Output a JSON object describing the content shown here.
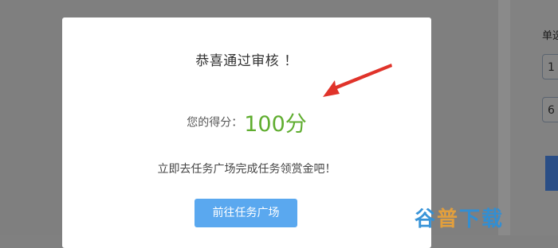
{
  "background": {
    "right_label": "单选",
    "input_one_value": "1",
    "input_two_value": "6"
  },
  "modal": {
    "title": "恭喜通过审核 ！",
    "score_label": "您的得分：",
    "score_value": "100分",
    "instruction": "立即去任务广场完成任务领赏金吧！",
    "button_label": "前往任务广场"
  },
  "watermark": {
    "text_part1": "谷",
    "text_part2": "普",
    "text_part3": "下载"
  },
  "colors": {
    "score_green": "#5fad2f",
    "button_blue": "#5aa8ef",
    "arrow_red": "#e0332a",
    "overlay": "#808080"
  }
}
